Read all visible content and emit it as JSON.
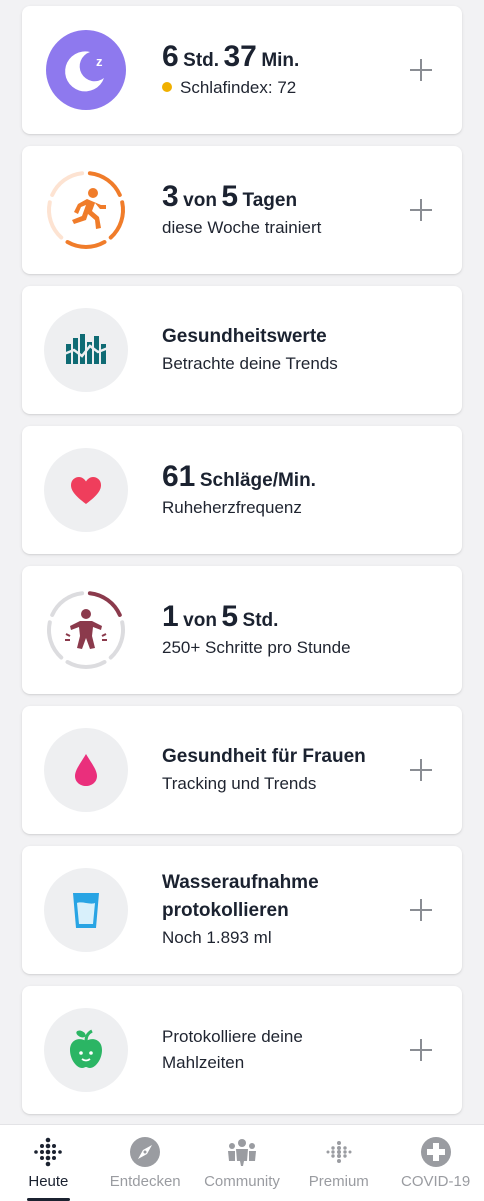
{
  "colors": {
    "sleep": "#8e79ee",
    "exercise": "#f07c2a",
    "health": "#0f6b74",
    "heart": "#ef3e5c",
    "active": "#8b3a4c",
    "female": "#ea2f7c",
    "water": "#28a4e4",
    "food": "#2bb564",
    "nav_active": "#1b2230",
    "nav_inactive": "#9a9ca1"
  },
  "cards": {
    "sleep": {
      "icon": "moon-sleep-icon",
      "hours": "6",
      "hours_unit": "Std.",
      "minutes": "37",
      "minutes_unit": "Min.",
      "score": "Schlafindex: 72"
    },
    "exercise": {
      "icon": "running-icon",
      "value": "3",
      "mid": "von",
      "goal": "5",
      "unit": "Tagen",
      "sub": "diese Woche trainiert",
      "progress_days": 3,
      "goal_days": 5
    },
    "health_metrics": {
      "icon": "health-bars-icon",
      "title": "Gesundheitswerte",
      "sub": "Betrachte deine Trends"
    },
    "heart_rate": {
      "icon": "heart-icon",
      "value": "61",
      "unit": "Schläge/Min.",
      "sub": "Ruheherzfrequenz"
    },
    "active_hours": {
      "icon": "standing-person-icon",
      "value": "1",
      "mid": "von",
      "goal": "5",
      "unit": "Std.",
      "sub": "250+ Schritte pro Stunde",
      "progress_hours": 1,
      "goal_hours": 5
    },
    "female_health": {
      "icon": "drop-icon",
      "title": "Gesundheit für Frauen",
      "sub": "Tracking und Trends"
    },
    "water": {
      "icon": "water-glass-icon",
      "title_line1": "Wasseraufnahme",
      "title_line2": "protokollieren",
      "sub": "Noch 1.893 ml"
    },
    "food": {
      "icon": "apple-icon",
      "line1": "Protokolliere deine",
      "line2": "Mahlzeiten"
    }
  },
  "nav": {
    "items": [
      {
        "label": "Heute",
        "icon": "fitbit-dots-icon",
        "active": true
      },
      {
        "label": "Entdecken",
        "icon": "compass-icon",
        "active": false
      },
      {
        "label": "Community",
        "icon": "community-icon",
        "active": false
      },
      {
        "label": "Premium",
        "icon": "premium-dots-icon",
        "active": false
      },
      {
        "label": "COVID-19",
        "icon": "medical-cross-icon",
        "active": false
      }
    ]
  }
}
